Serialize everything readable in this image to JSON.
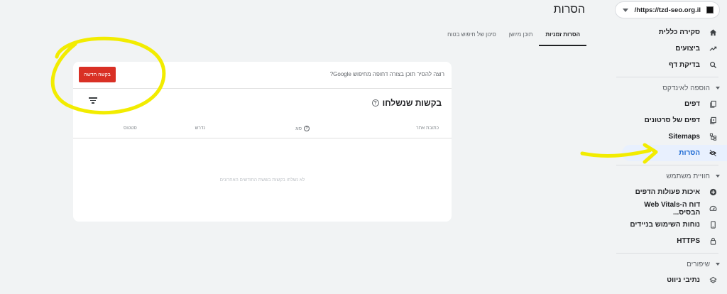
{
  "header": {
    "property": "https://tzd-seo.org.il/",
    "page_title": "הסרות"
  },
  "sidebar": {
    "items_top": [
      {
        "label": "סקירה כללית",
        "icon": "home-icon"
      },
      {
        "label": "ביצועים",
        "icon": "trending-icon"
      },
      {
        "label": "בדיקת דף",
        "icon": "search-icon"
      }
    ],
    "section_index": "הוספה לאינדקס",
    "items_index": [
      {
        "label": "דפים",
        "icon": "pages-icon"
      },
      {
        "label": "דפים של סרטונים",
        "icon": "video-pages-icon"
      },
      {
        "label": "Sitemaps",
        "icon": "sitemap-icon"
      },
      {
        "label": "הסרות",
        "icon": "eye-off-icon",
        "active": true
      }
    ],
    "section_experience": "חוויית משתמש",
    "items_experience": [
      {
        "label": "איכות פעולות הדפים",
        "icon": "plus-circle-icon"
      },
      {
        "label": "דוח ה-Web Vitals הבסיס...",
        "icon": "speed-icon"
      },
      {
        "label": "נוחות השימוש בניידים",
        "icon": "mobile-icon"
      },
      {
        "label": "HTTPS",
        "icon": "lock-icon"
      }
    ],
    "section_enhancements": "שיפורים",
    "items_enhancements": [
      {
        "label": "נתיבי ניווט",
        "icon": "layers-icon"
      }
    ]
  },
  "tabs": [
    {
      "label": "הסרות זמניות",
      "active": true
    },
    {
      "label": "תוכן מיושן",
      "active": false
    },
    {
      "label": "סינון של חיפוש בטוח",
      "active": false
    }
  ],
  "card": {
    "prompt": "רוצה להסיר תוכן בצורה דחופה מחיפוש Google?",
    "new_request_label": "בקשה חדשה",
    "title": "בקשות שנשלחו",
    "columns": {
      "url": "כתובת אתר",
      "type": "סוג",
      "requested": "נדרש",
      "status": "סטטוס"
    },
    "empty_message": "לא נשלחו בקשות בששת החודשים האחרונים"
  },
  "colors": {
    "accent": "#1967d2",
    "button": "#d93025",
    "annotation": "#f2ec00"
  }
}
